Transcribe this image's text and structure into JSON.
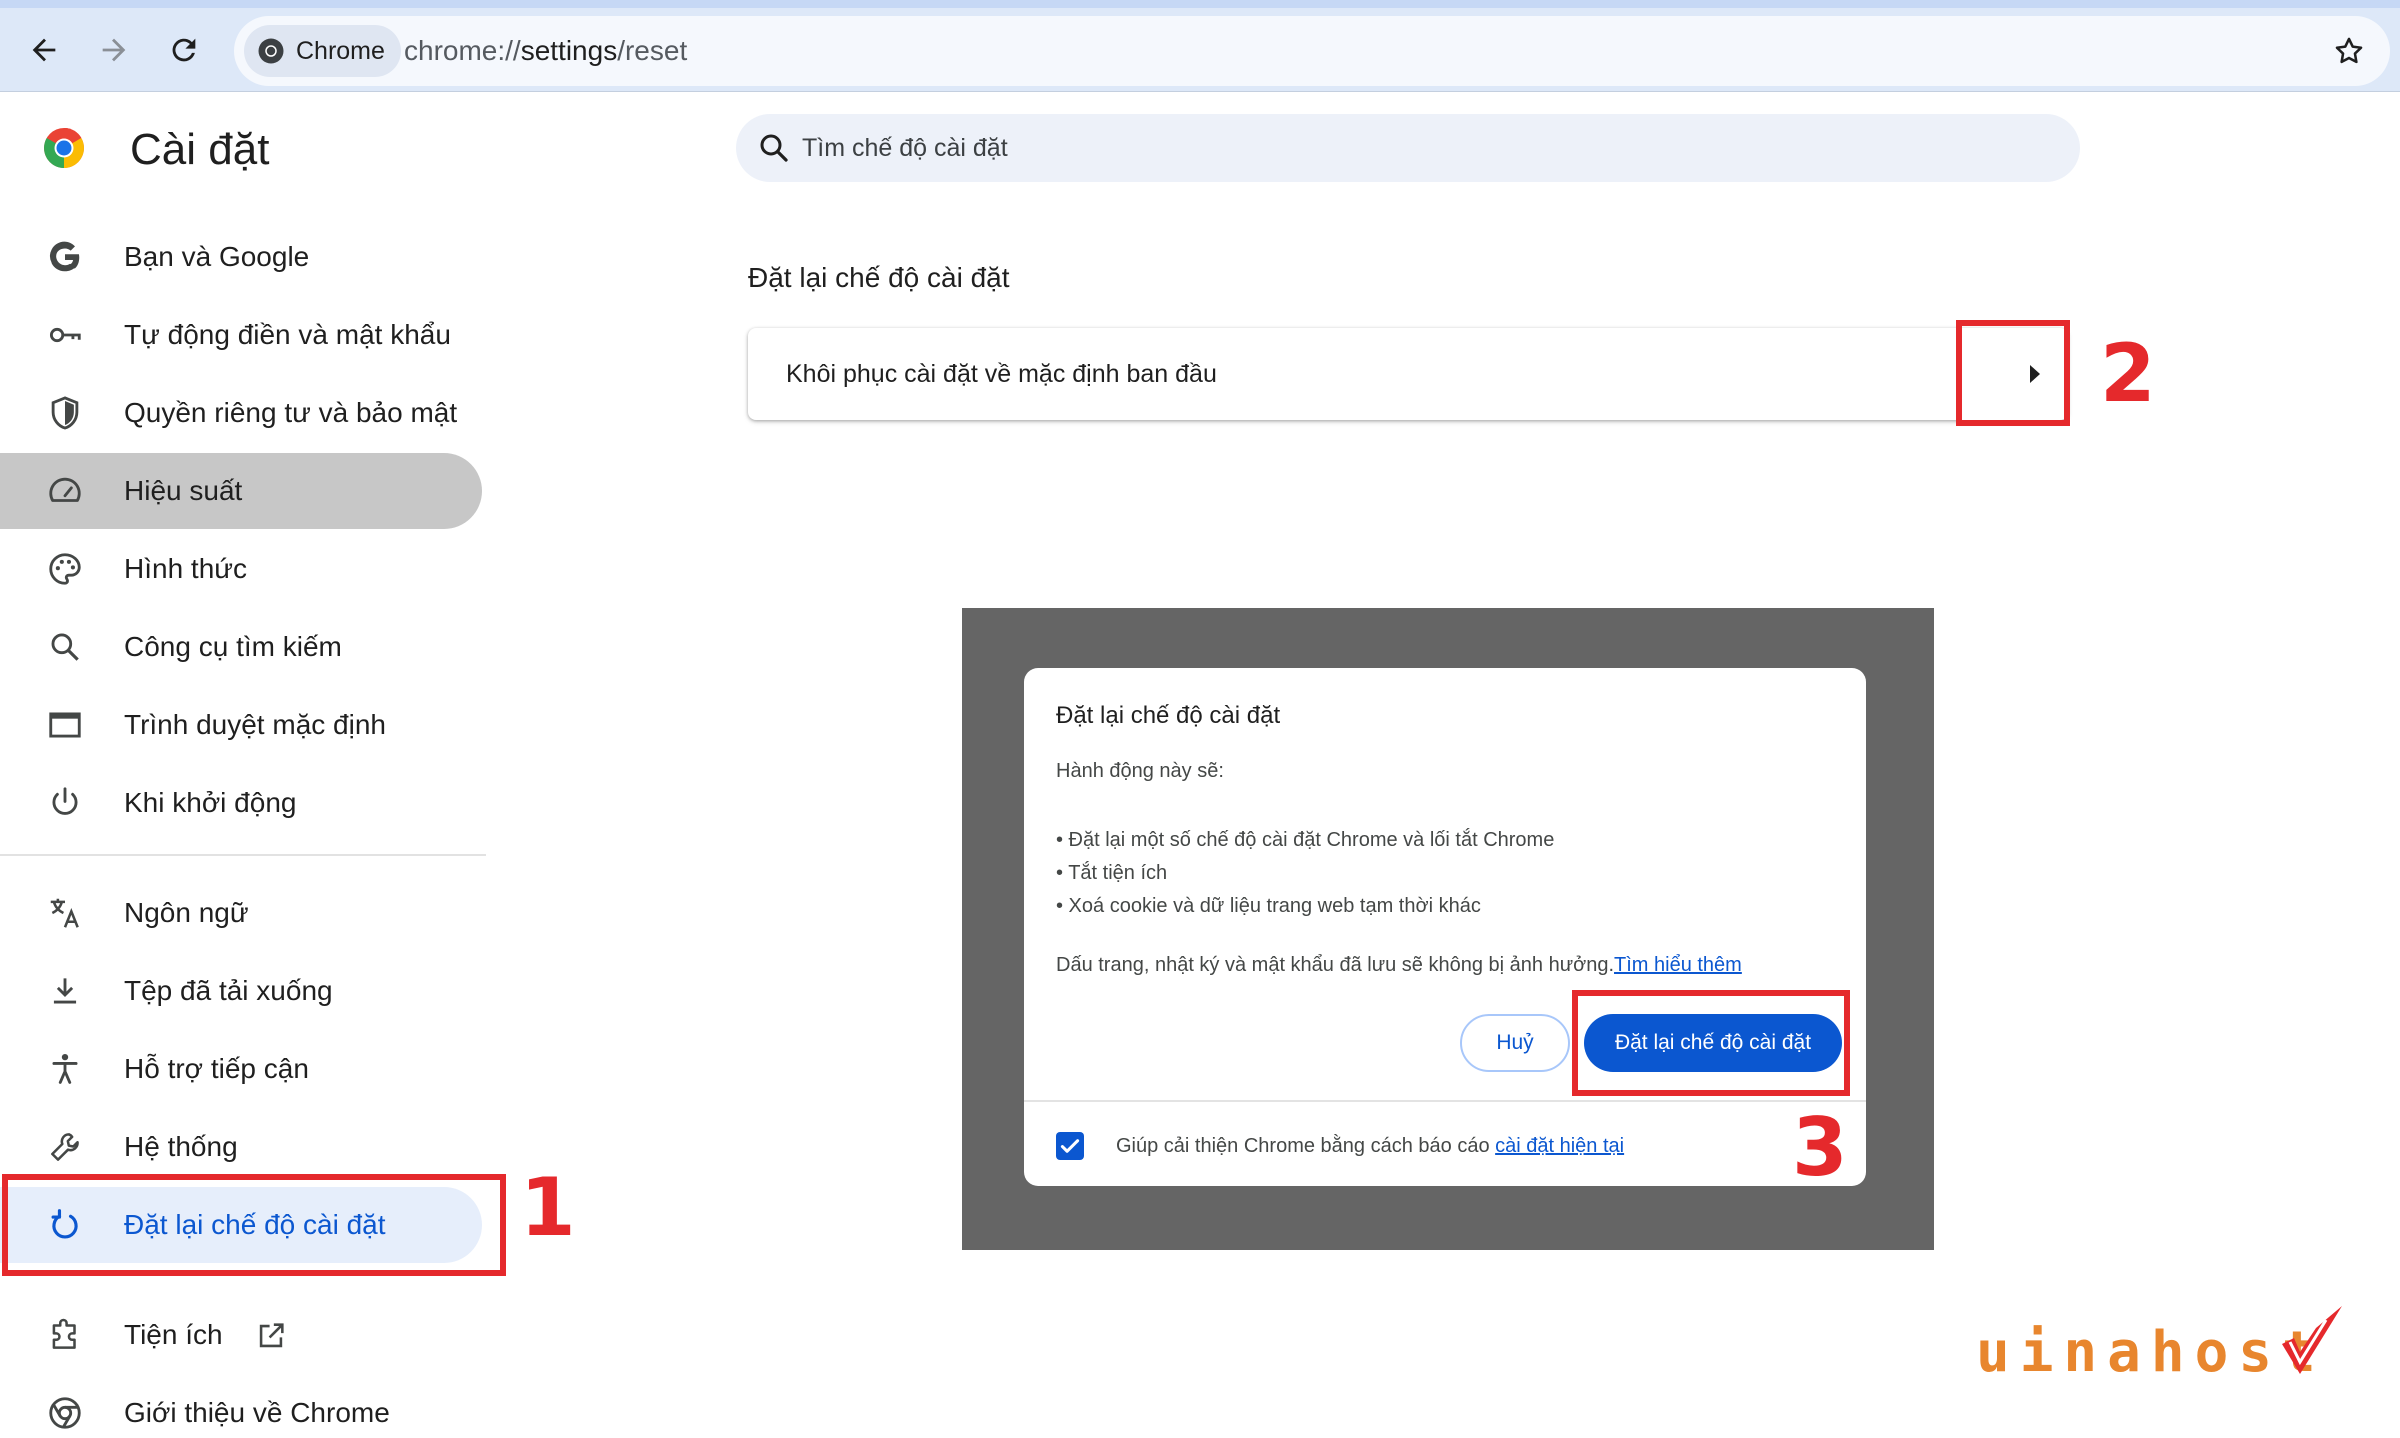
{
  "browser": {
    "chip_label": "Chrome",
    "url_prefix": "chrome://",
    "url_path": "settings",
    "url_suffix": "/reset"
  },
  "settings": {
    "title": "Cài đặt",
    "search_placeholder": "Tìm chế độ cài đặt"
  },
  "sidebar": {
    "items": [
      {
        "label": "Bạn và Google",
        "icon": "google-g-icon"
      },
      {
        "label": "Tự động điền và mật khẩu",
        "icon": "key-icon"
      },
      {
        "label": "Quyền riêng tư và bảo mật",
        "icon": "shield-icon"
      },
      {
        "label": "Hiệu suất",
        "icon": "speedometer-icon"
      },
      {
        "label": "Hình thức",
        "icon": "palette-icon"
      },
      {
        "label": "Công cụ tìm kiếm",
        "icon": "search-icon"
      },
      {
        "label": "Trình duyệt mặc định",
        "icon": "browser-window-icon"
      },
      {
        "label": "Khi khởi động",
        "icon": "power-icon"
      },
      {
        "label": "Ngôn ngữ",
        "icon": "translate-icon"
      },
      {
        "label": "Tệp đã tải xuống",
        "icon": "download-icon"
      },
      {
        "label": "Hỗ trợ tiếp cận",
        "icon": "accessibility-icon"
      },
      {
        "label": "Hệ thống",
        "icon": "wrench-icon"
      },
      {
        "label": "Đặt lại chế độ cài đặt",
        "icon": "reset-icon"
      },
      {
        "label": "Tiện ích",
        "icon": "puzzle-icon"
      },
      {
        "label": "Giới thiệu về Chrome",
        "icon": "chrome-icon"
      }
    ]
  },
  "main": {
    "section_title": "Đặt lại chế độ cài đặt",
    "reset_row_label": "Khôi phục cài đặt về mặc định ban đầu"
  },
  "dialog": {
    "title": "Đặt lại chế độ cài đặt",
    "intro": "Hành động này sẽ:",
    "bullets": [
      "• Đặt lại một số chế độ cài đặt Chrome và lối tắt Chrome",
      "• Tắt tiện ích",
      "• Xoá cookie và dữ liệu trang web tạm thời khác"
    ],
    "note": "Dấu trang, nhật ký và mật khẩu đã lưu sẽ không bị ảnh hưởng.",
    "learn_more": "Tìm hiểu thêm",
    "cancel_label": "Huỷ",
    "reset_label": "Đặt lại chế độ cài đặt",
    "footer_text": "Giúp cải thiện Chrome bằng cách báo cáo ",
    "footer_link": "cài đặt hiện tại",
    "checkbox_checked": true
  },
  "annotations": {
    "step1": "1",
    "step2": "2",
    "step3": "3",
    "color": "#e5292c"
  },
  "watermark": {
    "text": "uinahost"
  },
  "colors": {
    "accent": "#0b57d0",
    "active_item_bg": "#c7c7c7",
    "selected_item_bg": "#e6eefb",
    "logo_orange": "#e8862e"
  }
}
